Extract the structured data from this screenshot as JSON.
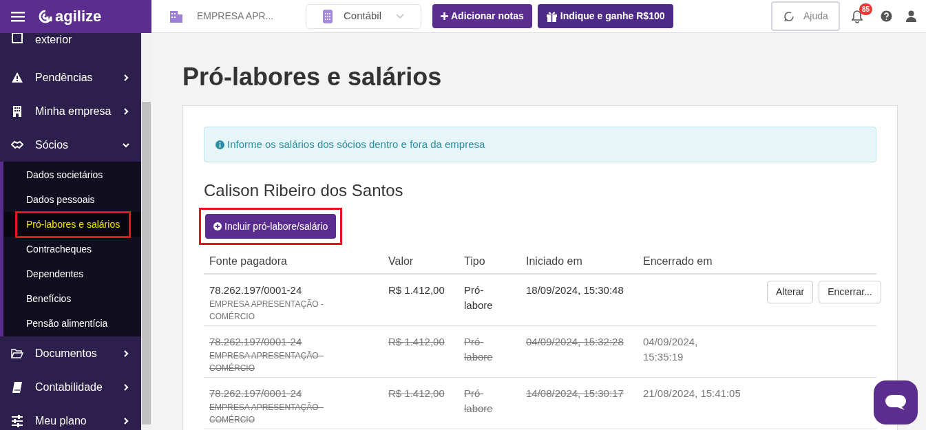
{
  "header": {
    "logo": "agilize",
    "company": "EMPRESA APR...",
    "module": "Contábil",
    "add_notes": "Adicionar notas",
    "referral": "Indique e ganhe R$100",
    "help": "Ajuda",
    "notifications": "85"
  },
  "sidebar": {
    "items": [
      {
        "label": "exterior",
        "kind": "partial"
      },
      {
        "label": "Pendências",
        "kind": "warning",
        "expanded": false
      },
      {
        "label": "Minha empresa",
        "kind": "building",
        "expanded": false
      },
      {
        "label": "Sócios",
        "kind": "handshake",
        "expanded": true,
        "children": [
          {
            "label": "Dados societários",
            "selected": false,
            "highlighted": false
          },
          {
            "label": "Dados pessoais",
            "selected": false,
            "highlighted": false
          },
          {
            "label": "Pró-labores e salários",
            "selected": true,
            "highlighted": true
          },
          {
            "label": "Contracheques",
            "selected": false,
            "highlighted": false
          },
          {
            "label": "Dependentes",
            "selected": false,
            "highlighted": false
          },
          {
            "label": "Benefícios",
            "selected": false,
            "highlighted": false
          },
          {
            "label": "Pensão alimentícia",
            "selected": false,
            "highlighted": false
          }
        ]
      },
      {
        "label": "Documentos",
        "kind": "folder",
        "expanded": false
      },
      {
        "label": "Contabilidade",
        "kind": "book",
        "expanded": false
      },
      {
        "label": "Meu plano",
        "kind": "sliders",
        "expanded": false
      }
    ]
  },
  "page": {
    "title": "Pró-labores e salários",
    "alert": "Informe os salários dos sócios dentro e fora da empresa",
    "partner": "Calison Ribeiro dos Santos",
    "add_button": {
      "label": "Incluir pró-labore/salário",
      "highlighted": true
    }
  },
  "table": {
    "columns": [
      "Fonte pagadora",
      "Valor",
      "Tipo",
      "Iniciado em",
      "Encerrado em"
    ],
    "rows": [
      {
        "cnpj": "78.262.197/0001-24",
        "company": "EMPRESA APRESENTAÇÃO - COMÉRCIO",
        "value": "R$ 1.412,00",
        "type": "Pró-labore",
        "start": "18/09/2024, 15:30:48",
        "ended": false,
        "actions": [
          "Alterar",
          "Encerrar..."
        ]
      },
      {
        "cnpj": "78.262.197/0001-24",
        "company": "EMPRESA APRESENTAÇÃO - COMÉRCIO",
        "value": "R$ 1.412,00",
        "type": "Pró-labore",
        "start": "04/09/2024, 15:32:28",
        "end": "04/09/2024, 15:35:19",
        "ended": true
      },
      {
        "cnpj": "78.262.197/0001-24",
        "company": "EMPRESA APRESENTAÇÃO - COMÉRCIO",
        "value": "R$ 1.412,00",
        "type": "Pró-labore",
        "start": "14/08/2024, 15:30:17",
        "end": "21/08/2024, 15:41:05",
        "ended": true
      }
    ]
  }
}
